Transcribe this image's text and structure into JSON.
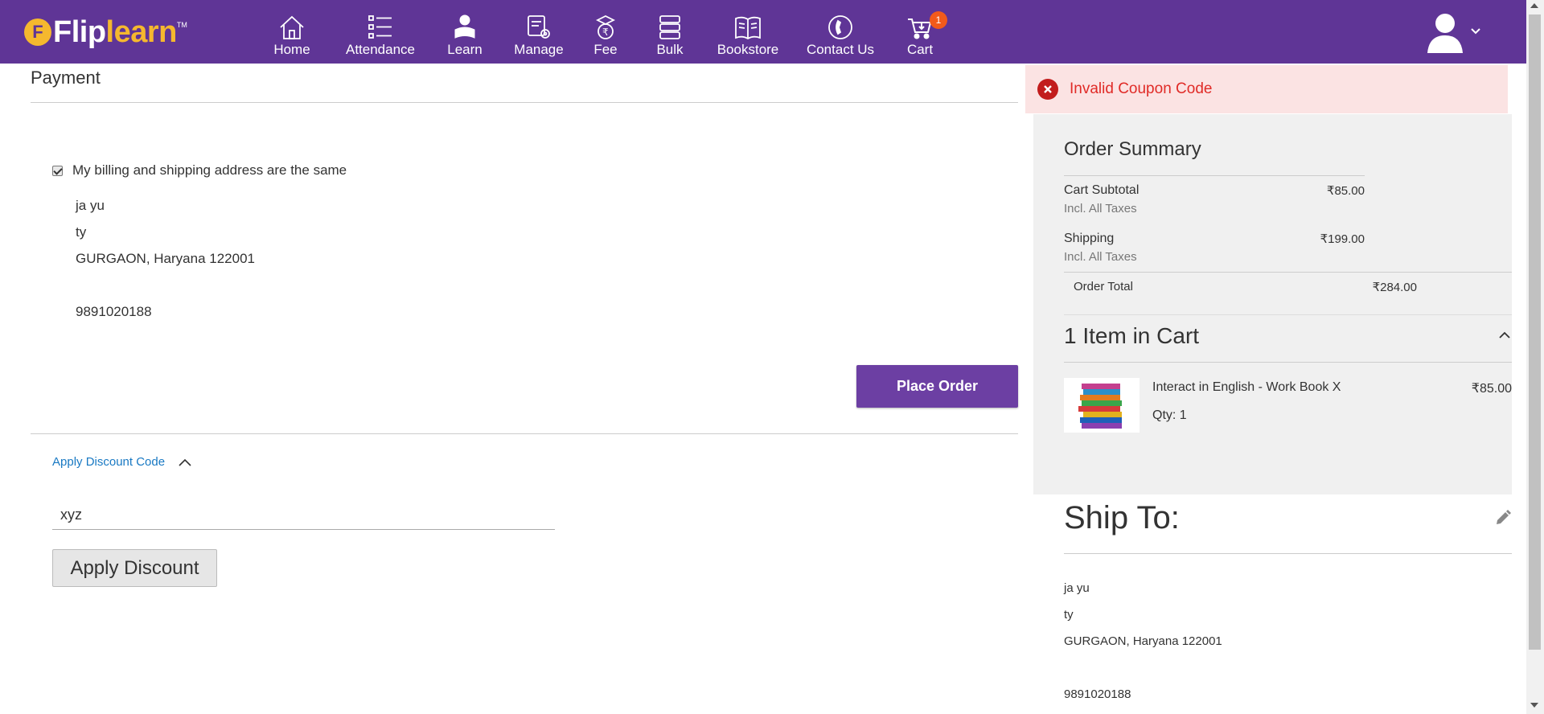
{
  "header": {
    "logo": {
      "part1": "Flip",
      "part2": "learn",
      "mark": "F",
      "tm": "TM"
    },
    "nav": [
      {
        "label": "Home",
        "icon": "home-icon"
      },
      {
        "label": "Attendance",
        "icon": "list-icon"
      },
      {
        "label": "Learn",
        "icon": "reader-icon"
      },
      {
        "label": "Manage",
        "icon": "manage-gear-icon"
      },
      {
        "label": "Fee",
        "icon": "rupee-graduate-icon"
      },
      {
        "label": "Bulk",
        "icon": "stack-icon"
      },
      {
        "label": "Bookstore",
        "icon": "book-icon"
      },
      {
        "label": "Contact Us",
        "icon": "phone-icon"
      },
      {
        "label": "Cart",
        "icon": "cart-icon"
      }
    ],
    "cart_badge": "1",
    "user_icon": "user-avatar-icon",
    "colors": {
      "header_bg": "#5f3596",
      "logo_accent": "#f5b82e",
      "badge": "#f25a1a"
    }
  },
  "payment": {
    "title": "Payment",
    "billing_same_label": "My billing and shipping address are the same",
    "billing_same_checked": true,
    "address": {
      "name": "ja yu",
      "street": "ty",
      "city_line": "GURGAON, Haryana 122001",
      "phone": "9891020188"
    },
    "place_order_label": "Place Order",
    "discount": {
      "toggle_label": "Apply Discount Code",
      "input_value": "xyz",
      "apply_label": "Apply Discount"
    }
  },
  "error": {
    "message": "Invalid Coupon Code",
    "color": "#e02b27"
  },
  "summary": {
    "title": "Order Summary",
    "subtotal_label": "Cart Subtotal",
    "subtotal_note": "Incl. All Taxes",
    "subtotal_value": "₹85.00",
    "shipping_label": "Shipping",
    "shipping_note": "Incl. All Taxes",
    "shipping_value": "₹199.00",
    "total_label": "Order Total",
    "total_value": "₹284.00",
    "items_in_cart": "1 Item in Cart",
    "item": {
      "name": "Interact in English - Work Book X",
      "qty": "Qty: 1",
      "price": "₹85.00"
    }
  },
  "ship_to": {
    "title": "Ship To:",
    "name": "ja yu",
    "street": "ty",
    "city_line": "GURGAON, Haryana 122001",
    "phone": "9891020188"
  }
}
